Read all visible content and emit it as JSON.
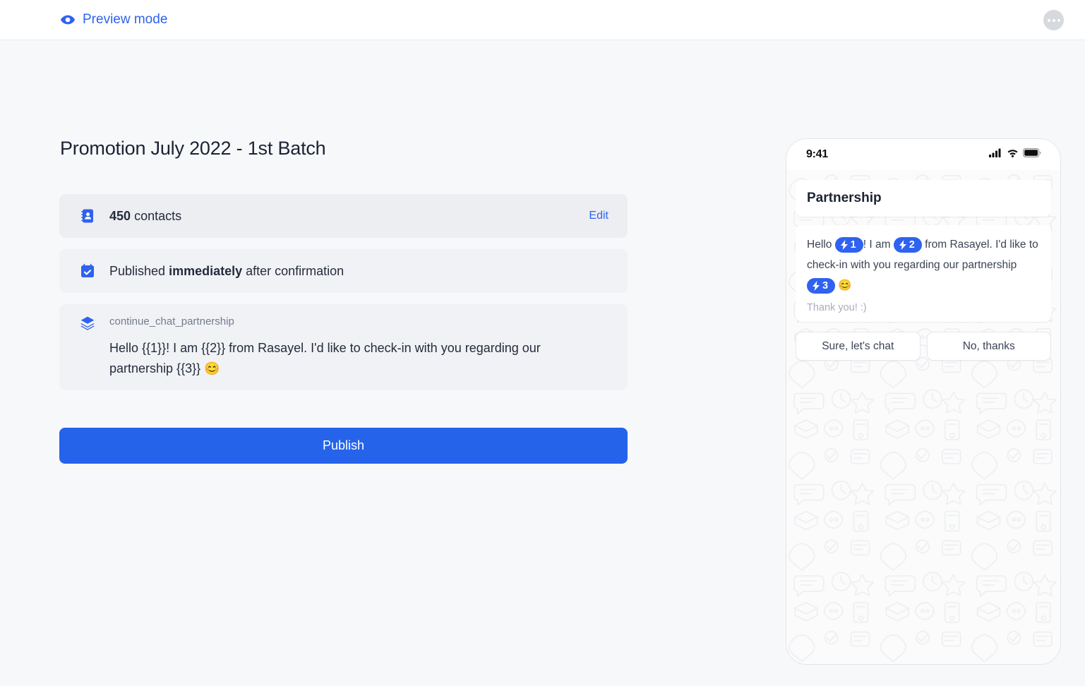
{
  "topbar": {
    "preview_label": "Preview mode",
    "preview_icon": "eye-icon",
    "more_icon": "ellipsis-icon",
    "accent_color": "#2f62f0"
  },
  "main": {
    "title": "Promotion July 2022 - 1st Batch",
    "contacts_card": {
      "icon": "address-book-icon",
      "count": "450",
      "label": "contacts",
      "edit_label": "Edit"
    },
    "schedule_card": {
      "icon": "calendar-check-icon",
      "prefix": "Published ",
      "emphasis": "immediately",
      "suffix": " after confirmation"
    },
    "template_card": {
      "icon": "layers-icon",
      "name": "continue_chat_partnership",
      "body": "Hello {{1}}! I am {{2}} from Rasayel. I'd like to check-in with you regarding our partnership {{3}} 😊"
    },
    "publish_label": "Publish"
  },
  "phone": {
    "status": {
      "time": "9:41",
      "signal_icon": "cellular-signal-icon",
      "wifi_icon": "wifi-icon",
      "battery_icon": "battery-icon"
    },
    "chat": {
      "header_text": "Partnership",
      "message": {
        "seg1": "Hello ",
        "ph1": "1",
        "seg2": "! I am ",
        "ph2": "2",
        "seg3": " from Rasayel. I'd like to check-in with you regarding our partnership ",
        "ph3": "3",
        "seg4": " 😊",
        "footer": "Thank you! :)"
      },
      "replies": [
        {
          "label": "Sure, let's chat"
        },
        {
          "label": "No, thanks"
        }
      ]
    }
  }
}
